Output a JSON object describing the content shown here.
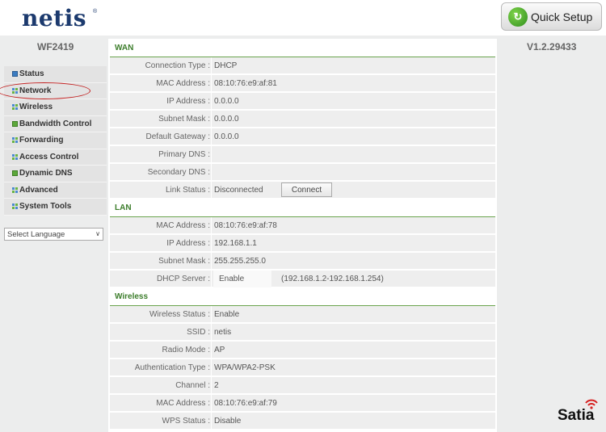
{
  "header": {
    "logo": "netis",
    "logo_mark": "®",
    "quick_setup_label": "Quick Setup"
  },
  "sidebar": {
    "model": "WF2419",
    "items": [
      {
        "label": "Status",
        "icon": "square-icon"
      },
      {
        "label": "Network",
        "icon": "grid-icon"
      },
      {
        "label": "Wireless",
        "icon": "grid-icon"
      },
      {
        "label": "Bandwidth Control",
        "icon": "green-square-icon"
      },
      {
        "label": "Forwarding",
        "icon": "grid-icon"
      },
      {
        "label": "Access Control",
        "icon": "grid-icon"
      },
      {
        "label": "Dynamic DNS",
        "icon": "green-square-icon"
      },
      {
        "label": "Advanced",
        "icon": "grid-icon"
      },
      {
        "label": "System Tools",
        "icon": "grid-icon"
      }
    ],
    "language_select": "Select Language"
  },
  "version": "V1.2.29433",
  "watermark": "Satia",
  "wan": {
    "title": "WAN",
    "rows": [
      {
        "label": "Connection Type :",
        "value": "DHCP"
      },
      {
        "label": "MAC Address :",
        "value": "08:10:76:e9:af:81"
      },
      {
        "label": "IP Address :",
        "value": "0.0.0.0"
      },
      {
        "label": "Subnet Mask :",
        "value": "0.0.0.0"
      },
      {
        "label": "Default Gateway :",
        "value": "0.0.0.0"
      },
      {
        "label": "Primary DNS :",
        "value": ""
      },
      {
        "label": "Secondary DNS :",
        "value": ""
      },
      {
        "label": "Link Status :",
        "value": "Disconnected"
      }
    ],
    "connect_label": "Connect"
  },
  "lan": {
    "title": "LAN",
    "rows": [
      {
        "label": "MAC Address :",
        "value": "08:10:76:e9:af:78"
      },
      {
        "label": "IP Address :",
        "value": "192.168.1.1"
      },
      {
        "label": "Subnet Mask :",
        "value": "255.255.255.0"
      },
      {
        "label": "DHCP Server :",
        "value": "Enable",
        "extra": "(192.168.1.2-192.168.1.254)"
      }
    ]
  },
  "wireless": {
    "title": "Wireless",
    "rows": [
      {
        "label": "Wireless Status :",
        "value": "Enable"
      },
      {
        "label": "SSID :",
        "value": "netis"
      },
      {
        "label": "Radio Mode :",
        "value": "AP"
      },
      {
        "label": "Authentication Type :",
        "value": "WPA/WPA2-PSK"
      },
      {
        "label": "Channel :",
        "value": "2"
      },
      {
        "label": "MAC Address :",
        "value": "08:10:76:e9:af:79"
      },
      {
        "label": "WPS Status :",
        "value": "Disable"
      }
    ]
  }
}
